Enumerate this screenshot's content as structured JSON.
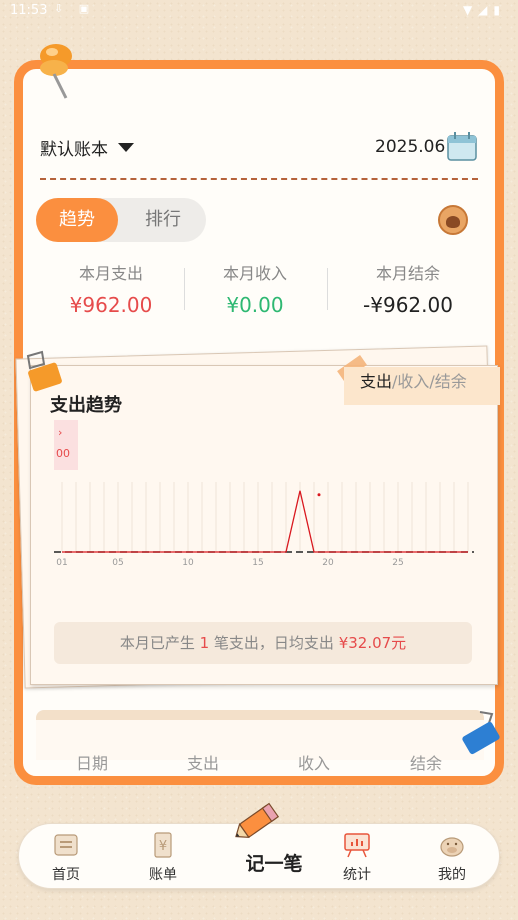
{
  "status_bar": {
    "time": "11:53"
  },
  "header": {
    "book_name": "默认账本",
    "month": "2025.06"
  },
  "segment": {
    "active": "趋势",
    "inactive": "排行"
  },
  "summary": {
    "expense_label": "本月支出",
    "expense_value": "¥962.00",
    "income_label": "本月收入",
    "income_value": "¥0.00",
    "balance_label": "本月结余",
    "balance_value": "-¥962.00"
  },
  "chart_section": {
    "title": "支出趋势",
    "tabs": [
      "支出",
      "/收入/结余"
    ],
    "tooltip_top": "›",
    "tooltip_value": "00"
  },
  "chart_data": {
    "type": "line",
    "title": "支出趋势",
    "x_ticks": [
      "01",
      "05",
      "10",
      "15",
      "20",
      "25"
    ],
    "x": [
      1,
      2,
      3,
      4,
      5,
      6,
      7,
      8,
      9,
      10,
      11,
      12,
      13,
      14,
      15,
      16,
      17,
      18,
      19,
      20,
      21,
      22,
      23,
      24,
      25,
      26,
      27,
      28,
      29,
      30
    ],
    "series": [
      {
        "values": [
          0,
          0,
          0,
          0,
          0,
          0,
          0,
          0,
          0,
          0,
          0,
          0,
          0,
          0,
          0,
          0,
          0,
          962,
          0,
          0,
          0,
          0,
          0,
          0,
          0,
          0,
          0,
          0,
          0,
          0
        ]
      }
    ],
    "ylim": [
      0,
      1100
    ],
    "colors": {
      "line": "#d9181f",
      "baseline": "#222222"
    }
  },
  "hint": {
    "prefix": "本月已产生 ",
    "count": "1",
    "middle": " 笔支出，日均支出 ",
    "amount": "¥32.07元"
  },
  "table": {
    "headers": [
      "日期",
      "支出",
      "收入",
      "结余"
    ]
  },
  "nav": {
    "home": "首页",
    "bills": "账单",
    "record": "记一笔",
    "stats": "统计",
    "mine": "我的"
  },
  "colors": {
    "accent": "#fb8f3f",
    "expense": "#e64b4b",
    "income": "#2eb872"
  }
}
